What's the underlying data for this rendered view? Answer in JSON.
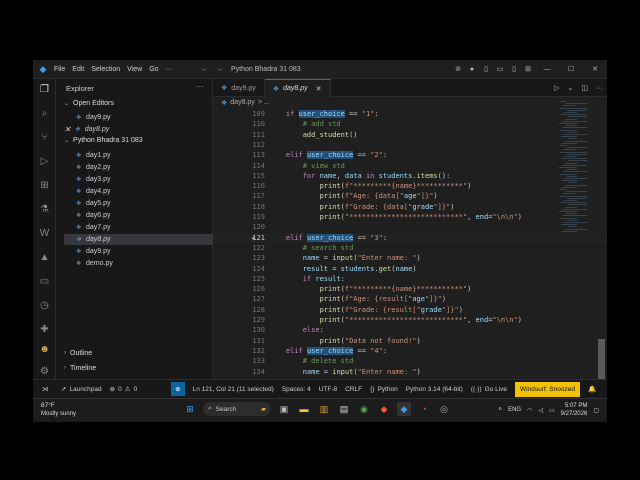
{
  "titlebar": {
    "menu": [
      "File",
      "Edit",
      "Selection",
      "View",
      "Go",
      "···"
    ],
    "back": "←",
    "forward": "→",
    "search_text": "Python Bhadra 31 083"
  },
  "sidebar": {
    "title": "Explorer",
    "open_editors_label": "Open Editors",
    "open_editors": [
      "day9.py",
      "day8.py"
    ],
    "folder_label": "Python Bhadra 31 083",
    "files": [
      "day1.py",
      "day2.py",
      "day3.py",
      "day4.py",
      "day5.py",
      "day6.py",
      "day7.py",
      "day8.py",
      "day9.py",
      "demo.py"
    ],
    "outline_label": "Outline",
    "timeline_label": "Timeline"
  },
  "tabs": [
    {
      "label": "day9.py"
    },
    {
      "label": "day8.py"
    }
  ],
  "breadcrumb": {
    "file": "day8.py",
    "more": "> ..."
  },
  "code": [
    {
      "n": "109",
      "t": "    if user_choice == \"1\":"
    },
    {
      "n": "110",
      "t": "        # add std"
    },
    {
      "n": "111",
      "t": "        add_student()"
    },
    {
      "n": "112",
      "t": ""
    },
    {
      "n": "113",
      "t": "    elif user_choice == \"2\":"
    },
    {
      "n": "114",
      "t": "        # view std"
    },
    {
      "n": "115",
      "t": "        for name, data in students.items():"
    },
    {
      "n": "116",
      "t": "            print(f\"*********{name}***********\")"
    },
    {
      "n": "117",
      "t": "            print(f\"Age: {data[\"age\"]}\")"
    },
    {
      "n": "118",
      "t": "            print(f\"Grade: {data[\"grade\"]}\")"
    },
    {
      "n": "119",
      "t": "            print(\"***************************\", end=\"\\n\\n\")"
    },
    {
      "n": "120",
      "t": ""
    },
    {
      "n": "121",
      "t": "    elif user_choice == \"3\":"
    },
    {
      "n": "122",
      "t": "        # search std"
    },
    {
      "n": "123",
      "t": "        name = input(\"Enter name: \")"
    },
    {
      "n": "124",
      "t": "        result = students.get(name)"
    },
    {
      "n": "125",
      "t": "        if result:"
    },
    {
      "n": "126",
      "t": "            print(f\"*********{name}***********\")"
    },
    {
      "n": "127",
      "t": "            print(f\"Age: {result[\"age\"]}\")"
    },
    {
      "n": "128",
      "t": "            print(f\"Grade: {result[\"grade\"]}\")"
    },
    {
      "n": "129",
      "t": "            print(\"***************************\", end=\"\\n\\n\")"
    },
    {
      "n": "130",
      "t": "        else:"
    },
    {
      "n": "131",
      "t": "            print(\"Data not found!\")"
    },
    {
      "n": "132",
      "t": "    elif user_choice == \"4\":"
    },
    {
      "n": "133",
      "t": "        # delete std"
    },
    {
      "n": "134",
      "t": "        name = input(\"Enter name: \")"
    }
  ],
  "statusbar": {
    "launchpad": "Launchpad",
    "errors": "0",
    "warnings": "0",
    "position": "Ln 121, Col 21 (11 selected)",
    "spaces": "Spaces: 4",
    "encoding": "UTF-8",
    "eol": "CRLF",
    "language": "Python",
    "interpreter": "Python 3.14 (64-bit)",
    "golive": "Go Live",
    "windsurf": "Windsurf: Snoozed"
  },
  "taskbar": {
    "temp": "87°F",
    "weather": "Mostly sunny",
    "search": "Search",
    "lang": "ENG",
    "time": "5:07 PM",
    "date": "9/27/2026"
  }
}
